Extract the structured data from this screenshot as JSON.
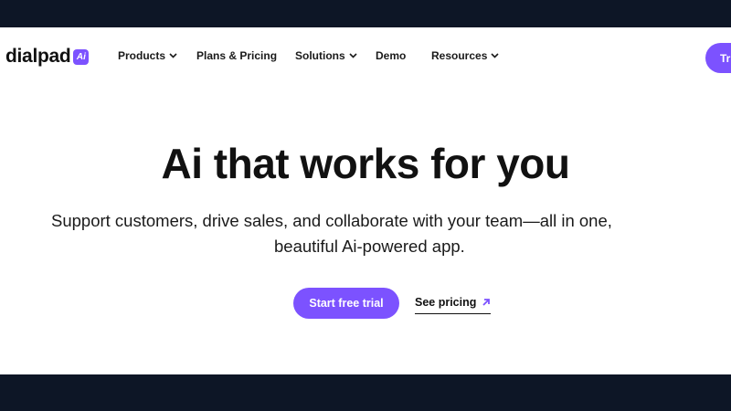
{
  "header": {
    "logo_text": "dialpad",
    "logo_badge": "Ai",
    "nav": [
      {
        "label": "Products",
        "has_dropdown": true
      },
      {
        "label": "Plans & Pricing",
        "has_dropdown": false
      },
      {
        "label": "Solutions",
        "has_dropdown": true
      },
      {
        "label": "Demo",
        "has_dropdown": false
      },
      {
        "label": "Resources",
        "has_dropdown": true
      }
    ],
    "trial_button_label": "Tr"
  },
  "hero": {
    "title": "Ai that works for you",
    "subtitle_line1": "Support customers, drive sales, and collaborate with your team—all in one,",
    "subtitle_line2": "beautiful Ai-powered app.",
    "primary_cta": "Start free trial",
    "secondary_cta": "See pricing"
  },
  "colors": {
    "accent": "#7c52ff",
    "frame": "#0d1626",
    "text": "#111111"
  },
  "icons": {
    "dropdown": "chevron-down-icon",
    "external_link": "arrow-up-right-icon"
  }
}
